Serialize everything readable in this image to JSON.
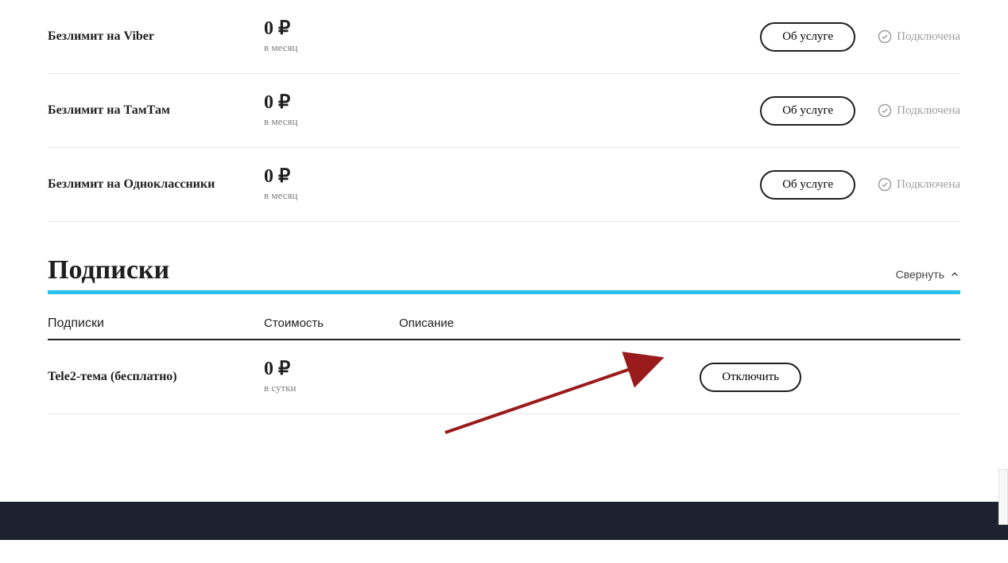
{
  "services": [
    {
      "name": "Безлимит на Viber",
      "price": "0 ₽",
      "period": "в месяц",
      "btn": "Об услуге",
      "status": "Подключена"
    },
    {
      "name": "Безлимит на ТамТам",
      "price": "0 ₽",
      "period": "в месяц",
      "btn": "Об услуге",
      "status": "Подключена"
    },
    {
      "name": "Безлимит на Одноклассники",
      "price": "0 ₽",
      "period": "в месяц",
      "btn": "Об услуге",
      "status": "Подключена"
    }
  ],
  "subs_section": {
    "title": "Подписки",
    "collapse": "Свернуть",
    "headers": {
      "name": "Подписки",
      "cost": "Стоимость",
      "desc": "Описание"
    }
  },
  "subscriptions": [
    {
      "name": "Tele2-тема (бесплатно)",
      "price": "0 ₽",
      "period": "в сутки",
      "btn": "Отключить"
    }
  ]
}
